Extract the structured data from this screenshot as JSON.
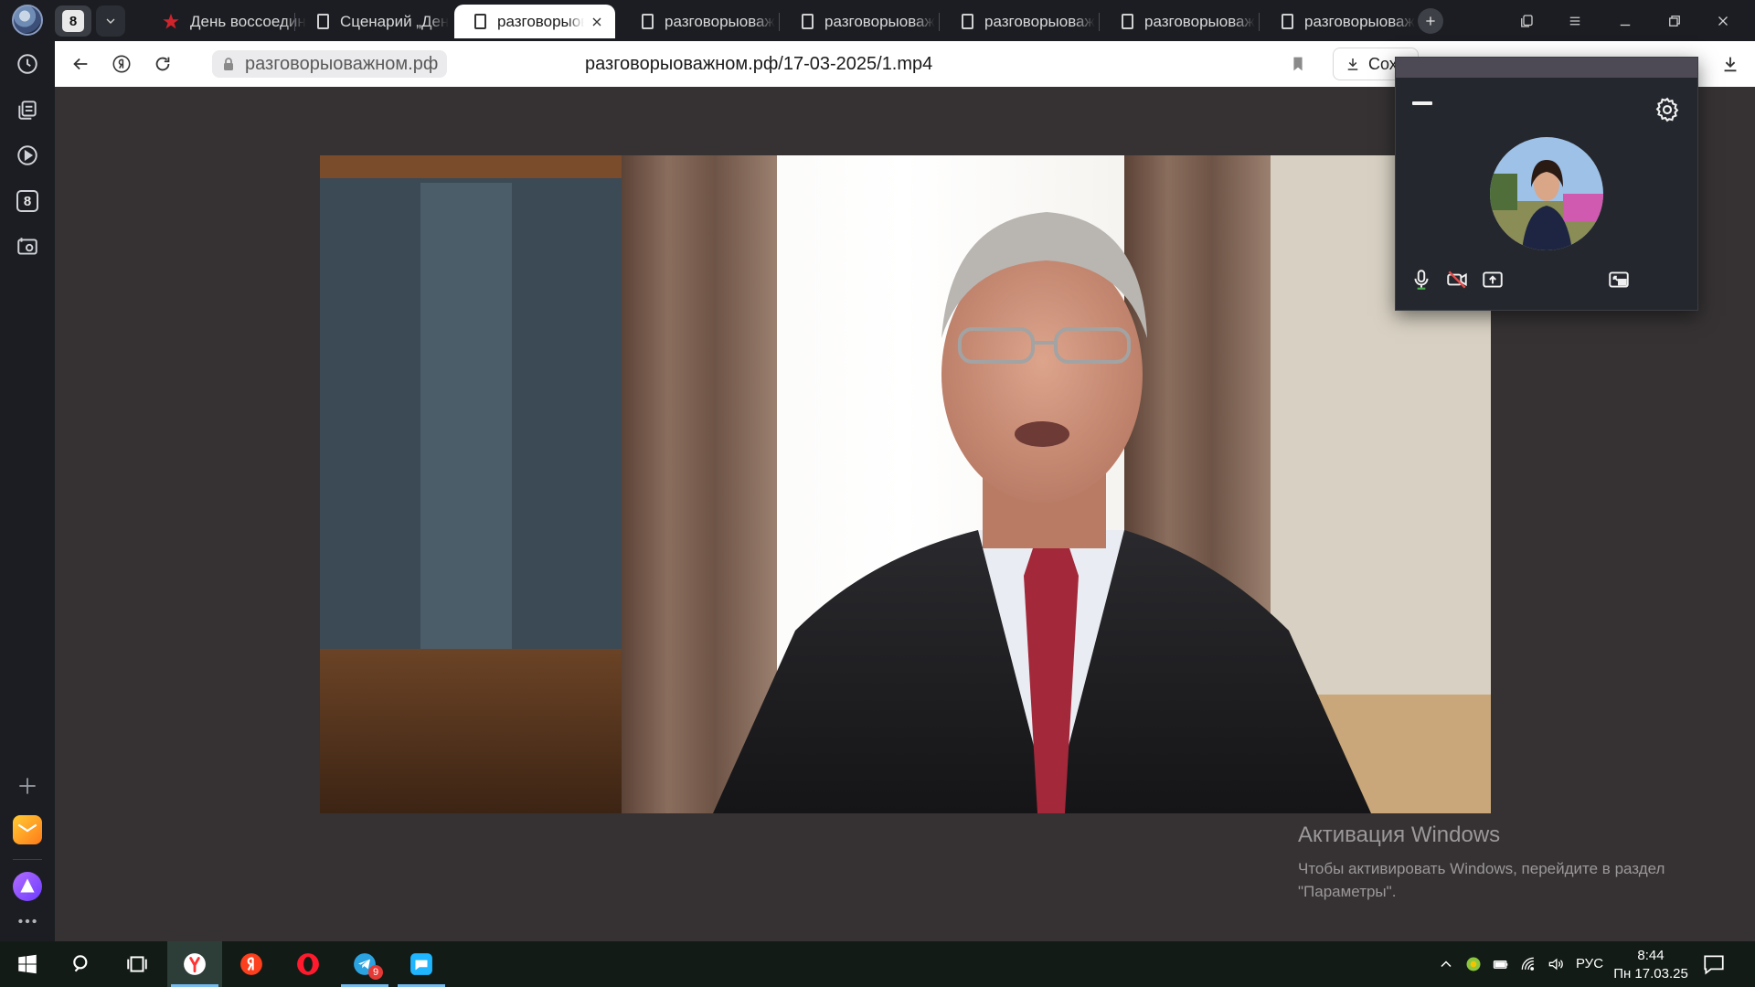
{
  "tabs": {
    "counter": "8",
    "items": [
      {
        "label": "День воссоедин",
        "type": "star"
      },
      {
        "label": "Сценарий „Ден",
        "type": "page"
      },
      {
        "label": "разговорыов",
        "type": "page",
        "active": true
      },
      {
        "label": "разговорыоваж",
        "type": "page"
      },
      {
        "label": "разговорыоваж",
        "type": "page"
      },
      {
        "label": "разговорыоваж",
        "type": "page"
      },
      {
        "label": "разговорыоваж",
        "type": "page"
      },
      {
        "label": "разговорыоваж",
        "type": "page"
      }
    ]
  },
  "sidebar": {
    "counter": "8",
    "items": [
      "history-icon",
      "collections-icon",
      "video-icon",
      "counter-icon",
      "screenshot-icon"
    ],
    "bottom": [
      "add-icon",
      "mail-app-icon",
      "alice-icon",
      "more-icon"
    ]
  },
  "navbar": {
    "domain": "разговорыоважном.рф",
    "path": "разговорыоважном.рф/17-03-2025/1.mp4",
    "save_label": "Сохр"
  },
  "call_widget": {
    "controls": [
      "microphone-icon",
      "camera-off-icon",
      "screen-share-icon",
      "pip-icon"
    ]
  },
  "activation": {
    "heading": "Активация Windows",
    "line1": "Чтобы активировать Windows, перейдите в раздел",
    "line2": "\"Параметры\"."
  },
  "taskbar": {
    "apps": [
      "yandex-browser",
      "yandex",
      "opera",
      "telegram",
      "max-messenger"
    ],
    "telegram_badge": "9",
    "lang": "РУС",
    "time": "8:44",
    "date": "Пн 17.03.25"
  },
  "colors": {
    "content_bg": "#363233",
    "accent": "#76b9ed"
  }
}
